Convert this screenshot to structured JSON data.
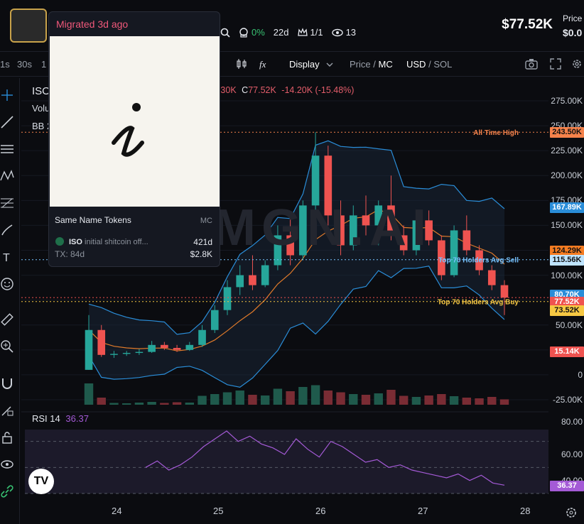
{
  "header": {
    "stats": {
      "change_pct": "0%",
      "age": "22d",
      "holders_ratio": "1/1",
      "views": "13"
    },
    "price": "$77.52K",
    "price_label": "Price",
    "price_value": "$0.0"
  },
  "toolbar": {
    "interval_1s": "1s",
    "interval_30s": "30s",
    "interval_1": "1",
    "display_label": "Display",
    "price_label": "Price",
    "mc_label": "MC",
    "usd_label": "USD",
    "sol_label": "SOL",
    "separator": "/"
  },
  "legend": {
    "symbol": "ISO",
    "vol_label": "Volu",
    "bb_label": "BB 2",
    "ohlc_h": "7.30K",
    "ohlc_c_label": "C",
    "ohlc_c": "77.52K",
    "ohlc_change": "-14.20K (-15.48%)"
  },
  "popup": {
    "title": "Migrated 3d ago",
    "section": "Same Name Tokens",
    "mc_header": "MC",
    "token": {
      "name": "ISO",
      "desc": "initial shitcoin off...",
      "age": "421d",
      "tx": "TX: 84d",
      "mc": "$2.8K"
    }
  },
  "annotations": {
    "ath": "All Time High",
    "avg_sell": "Top 70 Holders Avg Sell",
    "avg_buy": "Top 70 Holders Avg Buy"
  },
  "axis": {
    "ticks": [
      "275.00K",
      "250.00K",
      "225.00K",
      "200.00K",
      "175.00K",
      "150.00K",
      "125.00K",
      "100.00K",
      "75.00K",
      "50.00K",
      "25.00K",
      "0",
      "-25.00K"
    ],
    "tags": {
      "ath": "243.50K",
      "sell_hi": "167.89K",
      "p124": "124.29K",
      "avg_sell": "115.56K",
      "p80": "80.70K",
      "current": "77.52K",
      "avg_buy": "73.52K",
      "volume": "15.14K"
    },
    "rsi_ticks": [
      "80.00",
      "60.00",
      "40.00"
    ],
    "rsi_value": "36.37"
  },
  "rsi": {
    "label": "RSI",
    "period": "14",
    "value": "36.37"
  },
  "dates": [
    "24",
    "25",
    "26",
    "27",
    "28"
  ],
  "watermark": "MGN.AI",
  "colors": {
    "up": "#26a69a",
    "down": "#ef5350",
    "bb": "#2a8dd8",
    "ma": "#e07a2a",
    "rsi": "#a45ad6",
    "ath": "#f5824b",
    "avg_sell": "#77c3ff",
    "avg_buy": "#f7c843"
  },
  "chart_data": {
    "type": "candlestick",
    "ylim": [
      -30000,
      280000
    ],
    "candles": [
      {
        "o": 5000,
        "h": 60000,
        "l": 5000,
        "c": 45000
      },
      {
        "o": 45000,
        "h": 50000,
        "l": 18000,
        "c": 20000
      },
      {
        "o": 20000,
        "h": 24000,
        "l": 17000,
        "c": 21000
      },
      {
        "o": 21000,
        "h": 24000,
        "l": 19000,
        "c": 22000
      },
      {
        "o": 22000,
        "h": 26000,
        "l": 20000,
        "c": 23000
      },
      {
        "o": 23000,
        "h": 34000,
        "l": 22000,
        "c": 30000
      },
      {
        "o": 30000,
        "h": 33000,
        "l": 25000,
        "c": 27000
      },
      {
        "o": 27000,
        "h": 30000,
        "l": 23000,
        "c": 25000
      },
      {
        "o": 25000,
        "h": 33000,
        "l": 24000,
        "c": 30000
      },
      {
        "o": 30000,
        "h": 50000,
        "l": 28000,
        "c": 45000
      },
      {
        "o": 45000,
        "h": 70000,
        "l": 42000,
        "c": 65000
      },
      {
        "o": 65000,
        "h": 95000,
        "l": 60000,
        "c": 88000
      },
      {
        "o": 88000,
        "h": 110000,
        "l": 80000,
        "c": 100000
      },
      {
        "o": 100000,
        "h": 120000,
        "l": 85000,
        "c": 90000
      },
      {
        "o": 90000,
        "h": 115000,
        "l": 88000,
        "c": 110000
      },
      {
        "o": 110000,
        "h": 150000,
        "l": 105000,
        "c": 140000
      },
      {
        "o": 140000,
        "h": 160000,
        "l": 110000,
        "c": 120000
      },
      {
        "o": 120000,
        "h": 175000,
        "l": 115000,
        "c": 170000
      },
      {
        "o": 170000,
        "h": 243500,
        "l": 165000,
        "c": 220000
      },
      {
        "o": 220000,
        "h": 230000,
        "l": 150000,
        "c": 160000
      },
      {
        "o": 160000,
        "h": 175000,
        "l": 120000,
        "c": 130000
      },
      {
        "o": 130000,
        "h": 170000,
        "l": 125000,
        "c": 160000
      },
      {
        "o": 160000,
        "h": 180000,
        "l": 140000,
        "c": 150000
      },
      {
        "o": 150000,
        "h": 175000,
        "l": 130000,
        "c": 170000
      },
      {
        "o": 170000,
        "h": 200000,
        "l": 135000,
        "c": 140000
      },
      {
        "o": 140000,
        "h": 150000,
        "l": 120000,
        "c": 125000
      },
      {
        "o": 125000,
        "h": 160000,
        "l": 120000,
        "c": 155000
      },
      {
        "o": 155000,
        "h": 165000,
        "l": 130000,
        "c": 135000
      },
      {
        "o": 135000,
        "h": 140000,
        "l": 95000,
        "c": 100000
      },
      {
        "o": 100000,
        "h": 150000,
        "l": 98000,
        "c": 145000
      },
      {
        "o": 145000,
        "h": 160000,
        "l": 120000,
        "c": 125000
      },
      {
        "o": 125000,
        "h": 130000,
        "l": 100000,
        "c": 105000
      },
      {
        "o": 105000,
        "h": 110000,
        "l": 85000,
        "c": 90000
      },
      {
        "o": 90000,
        "h": 95000,
        "l": 60000,
        "c": 77520
      }
    ],
    "volume": [
      60000,
      20000,
      5000,
      4000,
      6000,
      8000,
      5000,
      7000,
      6000,
      25000,
      30000,
      35000,
      40000,
      28000,
      26000,
      45000,
      38000,
      50000,
      55000,
      40000,
      35000,
      30000,
      28000,
      32000,
      42000,
      25000,
      22000,
      26000,
      30000,
      24000,
      20000,
      18000,
      22000,
      15140
    ],
    "rsi": [
      50,
      55,
      48,
      52,
      58,
      66,
      72,
      78,
      70,
      74,
      68,
      65,
      60,
      72,
      64,
      58,
      70,
      66,
      60,
      54,
      56,
      50,
      52,
      48,
      46,
      44,
      42,
      45,
      40,
      44,
      38,
      36.37
    ]
  }
}
